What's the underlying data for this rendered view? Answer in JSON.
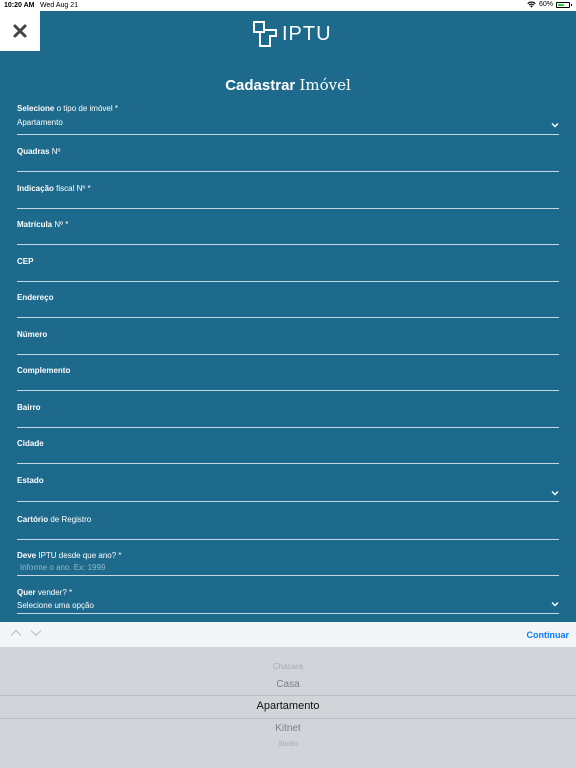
{
  "status_bar": {
    "time": "10:20 AM",
    "date": "Wed Aug 21",
    "battery": "60%",
    "battery_level": 0.6
  },
  "header": {
    "logo_text": "IPTU"
  },
  "page": {
    "title_bold": "Cadastrar",
    "title_rest": "Imóvel"
  },
  "fields": {
    "tipo": {
      "label_bold": "Selecione",
      "label_rest": " o tipo de imóvel *",
      "value": "Apartamento"
    },
    "quadras": {
      "label_bold": "Quadras",
      "label_rest": " Nº"
    },
    "indicacao": {
      "label_bold": "Indicação",
      "label_rest": " fiscal Nº *"
    },
    "matricula": {
      "label_bold": "Matrícula",
      "label_rest": " Nº *"
    },
    "cep": {
      "label_bold": "CEP",
      "label_rest": ""
    },
    "endereco": {
      "label_bold": "Endereço",
      "label_rest": ""
    },
    "numero": {
      "label_bold": "Número",
      "label_rest": ""
    },
    "complemento": {
      "label_bold": "Complemento",
      "label_rest": ""
    },
    "bairro": {
      "label_bold": "Bairro",
      "label_rest": ""
    },
    "cidade": {
      "label_bold": "Cidade",
      "label_rest": ""
    },
    "estado": {
      "label_bold": "Estado",
      "label_rest": ""
    },
    "cartorio": {
      "label_bold": "Cartório",
      "label_rest": " de Registro"
    },
    "deve_iptu": {
      "label_bold": "Deve",
      "label_rest": " IPTU desde que ano? *",
      "placeholder": "Informe o ano. Ex: 1999"
    },
    "vender": {
      "label_bold": "Quer",
      "label_rest": " vender? *",
      "value": "Selecione uma opção"
    }
  },
  "toolbar": {
    "continue_label": "Continuar"
  },
  "picker": {
    "options": [
      "Chácara",
      "Casa",
      "Apartamento",
      "Kitnet",
      "Studio"
    ],
    "selected": "Apartamento"
  },
  "colors": {
    "background": "#1e6a8c",
    "accent": "#0a7cff"
  }
}
